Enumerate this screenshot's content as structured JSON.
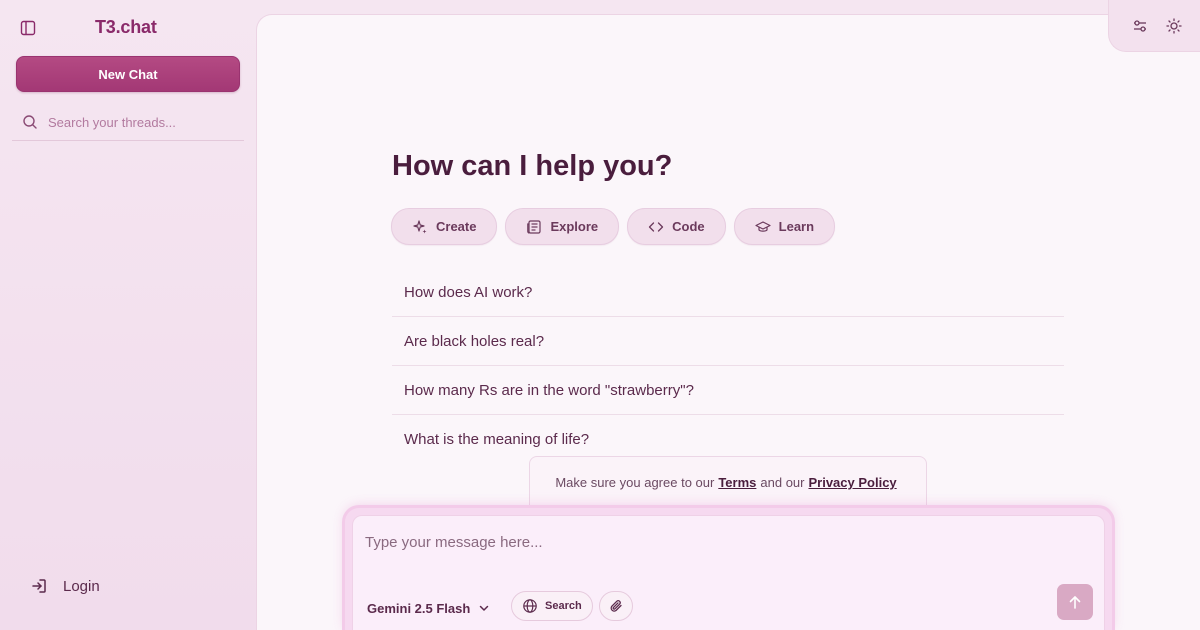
{
  "sidebar": {
    "brand": "T3.chat",
    "new_chat_label": "New Chat",
    "search_placeholder": "Search your threads...",
    "login_label": "Login"
  },
  "main": {
    "heading": "How can I help you?",
    "chips": [
      {
        "label": "Create",
        "icon": "sparkles-icon"
      },
      {
        "label": "Explore",
        "icon": "newspaper-icon"
      },
      {
        "label": "Code",
        "icon": "code-icon"
      },
      {
        "label": "Learn",
        "icon": "graduation-cap-icon"
      }
    ],
    "suggestions": [
      "How does AI work?",
      "Are black holes real?",
      "How many Rs are in the word \"strawberry\"?",
      "What is the meaning of life?"
    ]
  },
  "terms": {
    "prefix": "Make sure you agree to our",
    "terms_link": "Terms",
    "middle": "and our",
    "privacy_link": "Privacy Policy"
  },
  "composer": {
    "placeholder": "Type your message here...",
    "model": "Gemini 2.5 Flash",
    "search_label": "Search"
  },
  "colors": {
    "accent": "#a33875",
    "background": "#f5e6f1",
    "panel": "#fbf6fa",
    "send_button": "#d9a9c4"
  }
}
